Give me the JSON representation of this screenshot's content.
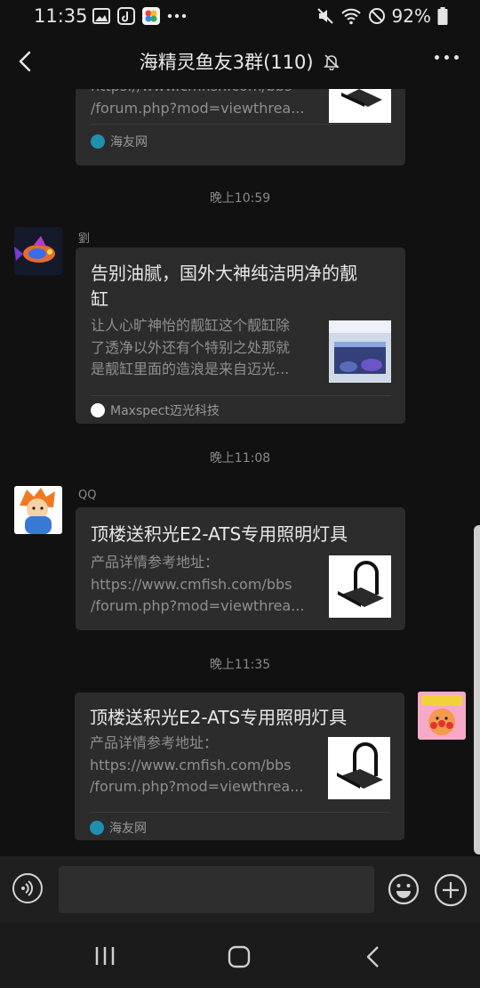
{
  "status_bar": {
    "time": "11:35",
    "battery": "92%",
    "left_icons": [
      "image-icon",
      "tiktok-icon",
      "photos-icon",
      "more-dots-icon"
    ],
    "right_icons": [
      "mute-icon",
      "wifi-icon",
      "dnd-icon",
      "battery-icon"
    ]
  },
  "header": {
    "title": "海精灵鱼友3群(110)",
    "muted_icon": "bell-off-icon"
  },
  "messages": {
    "m1": {
      "desc": "https://www.cmfish.com/bbs\n/forum.php?mod=viewthrea...",
      "source": "海友网"
    },
    "t1": "晚上10:59",
    "m2": {
      "sender": "劉",
      "title": "告别油腻，国外大神纯洁明净的靓\n缸",
      "desc": "让人心旷神怡的靓缸这个靓缸除\n了透净以外还有个特别之处那就\n是靓缸里面的造浪是来自迈光...",
      "source": "Maxspect迈光科技"
    },
    "t2": "晚上11:08",
    "m3": {
      "sender": "QQ",
      "title": "顶楼送积光E2-ATS专用照明灯具",
      "desc": "产品详情参考地址：\nhttps://www.cmfish.com/bbs\n/forum.php?mod=viewthrea..."
    },
    "t3": "晚上11:35",
    "m4": {
      "title": "顶楼送积光E2-ATS专用照明灯具",
      "desc": "产品详情参考地址：\nhttps://www.cmfish.com/bbs\n/forum.php?mod=viewthrea...",
      "source": "海友网"
    }
  },
  "input_bar": {
    "value": "",
    "icons": [
      "voice-icon",
      "emoji-icon",
      "plus-icon"
    ]
  },
  "nav_bar": {
    "icons": [
      "recent-apps-icon",
      "home-icon",
      "back-icon"
    ]
  },
  "colors": {
    "background": "#111111",
    "card": "#2c2c2c",
    "input_bar": "#1f1f1f",
    "hyf_icon": "#1f8fb0",
    "maxspect_icon": "#ffffff"
  }
}
